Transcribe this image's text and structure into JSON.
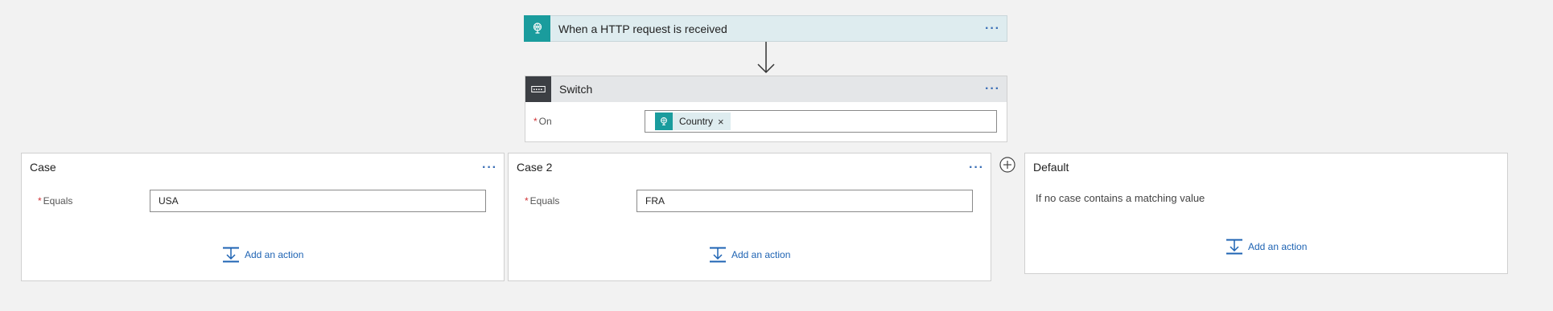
{
  "trigger": {
    "title": "When a HTTP request is received",
    "more_label": "···",
    "icon": "http-request-globe-icon",
    "accent": "#1a9c9d"
  },
  "switch": {
    "title": "Switch",
    "more_label": "···",
    "icon": "switch-icon",
    "on_label": "On",
    "required_mark": "*",
    "token_label": "Country",
    "token_remove": "×"
  },
  "cases": [
    {
      "title": "Case",
      "more_label": "···",
      "equals_label": "Equals",
      "equals_value": "USA",
      "add_action_label": "Add an action"
    },
    {
      "title": "Case 2",
      "more_label": "···",
      "equals_label": "Equals",
      "equals_value": "FRA",
      "add_action_label": "Add an action"
    }
  ],
  "default_case": {
    "title": "Default",
    "description": "If no case contains a matching value",
    "add_action_label": "Add an action"
  },
  "colors": {
    "background": "#f2f2f2",
    "link": "#1e63b3",
    "required": "#d13438",
    "switch_icon_bg": "#3c3f44"
  }
}
